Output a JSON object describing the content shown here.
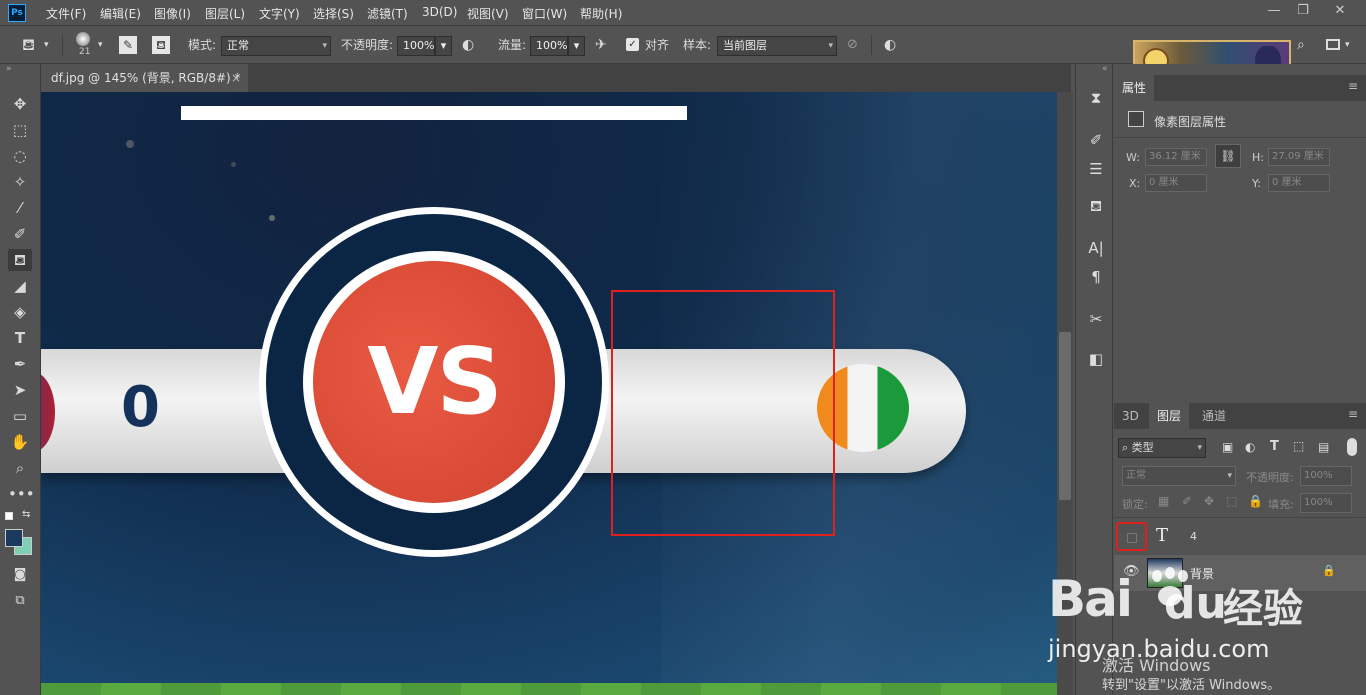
{
  "app": {
    "logo_text": "Ps"
  },
  "menu": [
    "文件(F)",
    "编辑(E)",
    "图像(I)",
    "图层(L)",
    "文字(Y)",
    "选择(S)",
    "滤镜(T)",
    "3D(D)",
    "视图(V)",
    "窗口(W)",
    "帮助(H)"
  ],
  "window_controls": {
    "minimize": "—",
    "restore": "❐",
    "close": "✕"
  },
  "options": {
    "brush_size": "21",
    "mode_label": "模式:",
    "mode_value": "正常",
    "opacity_label": "不透明度:",
    "opacity_value": "100%",
    "flow_label": "流量:",
    "flow_value": "100%",
    "align_label": "对齐",
    "sample_label": "样本:",
    "sample_value": "当前图层"
  },
  "document": {
    "tab_title": "df.jpg @ 145% (背景, RGB/8#) *",
    "close": "×"
  },
  "canvas": {
    "score_left": "0",
    "vs_text": "VS"
  },
  "properties": {
    "tab": "属性",
    "kind": "像素图层属性",
    "w_label": "W:",
    "w_value": "36.12 厘米",
    "h_label": "H:",
    "h_value": "27.09 厘米",
    "x_label": "X:",
    "x_value": "0 厘米",
    "y_label": "Y:",
    "y_value": "0 厘米"
  },
  "layers_panel": {
    "tabs": [
      "3D",
      "图层",
      "通道"
    ],
    "filter_label": "类型",
    "blend_mode": "正常",
    "opacity_label": "不透明度:",
    "opacity_value": "100%",
    "lock_label": "锁定:",
    "fill_label": "填充:",
    "fill_value": "100%",
    "layers": [
      {
        "type_icon": "T",
        "name": "4"
      },
      {
        "name": "背景"
      }
    ]
  },
  "watermark": {
    "brand_a": "Bai",
    "brand_b": "du",
    "brand_cn": "经验",
    "url": "jingyan.baidu.com",
    "activate_title": "激活 Windows",
    "activate_sub": "转到\"设置\"以激活 Windows。"
  },
  "colors": {
    "foreground": "#1c3a5e",
    "background": "#7ecfb3",
    "selection_outline": "#e0201c",
    "vs_red": "#d94a36"
  }
}
